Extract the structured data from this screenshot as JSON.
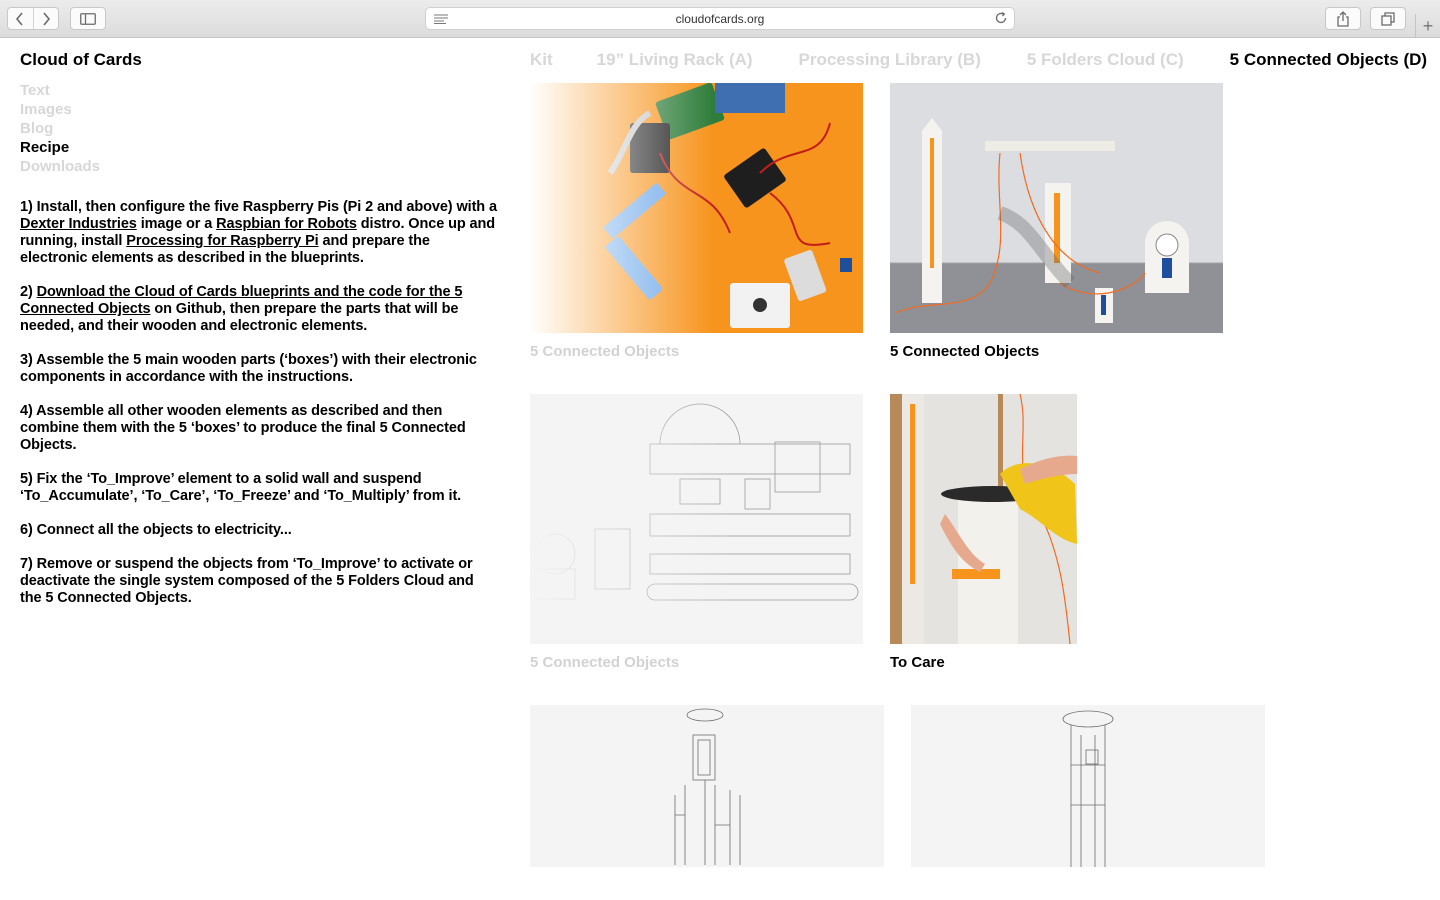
{
  "browser": {
    "url": "cloudofcards.org",
    "icons": [
      "back-icon",
      "forward-icon",
      "sidebar-icon",
      "reader-icon",
      "reload-icon",
      "share-icon",
      "tabs-icon",
      "plus-icon"
    ],
    "new_tab_glyph": "+"
  },
  "site": {
    "title": "Cloud of Cards",
    "sidenav": [
      "Text",
      "Images",
      "Blog",
      "Recipe",
      "Downloads"
    ],
    "topnav": [
      "Kit",
      "19” Living Rack (A)",
      "Processing Library (B)",
      "5 Folders Cloud (C)",
      "5 Connected Objects (D)"
    ]
  },
  "recipe": {
    "s1": {
      "a": "1) Install, then configure the five Raspberry Pis (Pi 2 and above) with a ",
      "link1": "Dexter Industries",
      "b": " image or a ",
      "link2": "Raspbian for Robots",
      "c": " distro. Once up and running, install ",
      "link3": "Processing for Raspberry Pi",
      "d": " and prepare the electronic elements as described in the blueprints."
    },
    "s2": {
      "a": "2) ",
      "link1": "Download the Cloud of Cards blueprints and the code for the 5 Connected Objects",
      "b": " on Github, then prepare the parts that will be needed, and their wooden and electronic elements."
    },
    "s3": "3) Assemble the 5 main wooden parts (‘boxes’) with their electronic components in accordance with the instructions.",
    "s4": "4) Assemble all other wooden elements as described and then combine them with the 5 ‘boxes’ to produce the final 5 Connected Objects.",
    "s5": "5) Fix the ‘To_Improve’ element to a solid wall and suspend ‘To_Accumulate’, ‘To_Care’, ‘To_Freeze’ and ‘To_Multiply’ from it.",
    "s6": "6) Connect all the objects to electricity...",
    "s7": "7) Remove or suspend the objects from ‘To_Improve’ to activate or deactivate the single system composed of the 5 Folders Cloud and the 5 Connected Objects."
  },
  "gallery": [
    {
      "caption": "5 Connected Objects"
    },
    {
      "caption": "5 Connected Objects"
    },
    {
      "caption": "5 Connected Objects"
    },
    {
      "caption": "To Care"
    },
    {
      "caption": ""
    },
    {
      "caption": ""
    }
  ],
  "colors": {
    "active": "#000000",
    "inactive": "#d7d7d7",
    "kit_orange": "#f7941d"
  }
}
